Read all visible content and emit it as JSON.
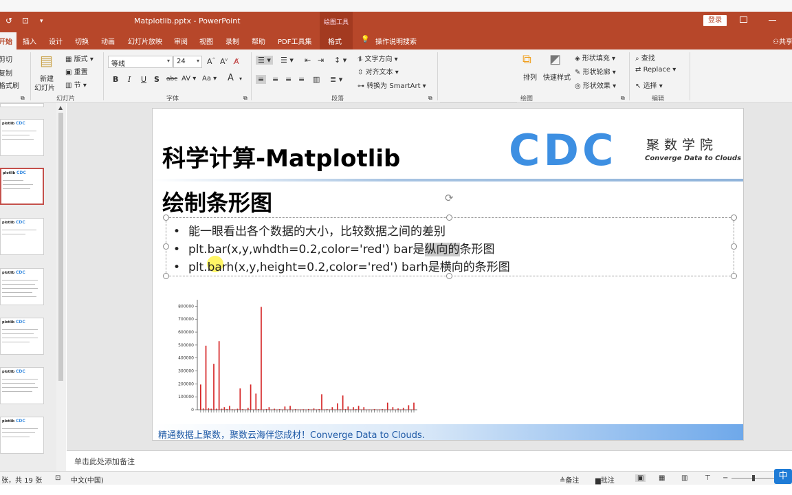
{
  "window": {
    "doc_title": "Matplotlib.pptx - PowerPoint",
    "context_tab_group": "绘图工具",
    "login_label": "登录"
  },
  "tabs": [
    {
      "label": "开始"
    },
    {
      "label": "插入"
    },
    {
      "label": "设计"
    },
    {
      "label": "切换"
    },
    {
      "label": "动画"
    },
    {
      "label": "幻灯片放映"
    },
    {
      "label": "审阅"
    },
    {
      "label": "视图"
    },
    {
      "label": "录制"
    },
    {
      "label": "帮助"
    },
    {
      "label": "PDF工具集"
    },
    {
      "label": "格式"
    },
    {
      "label": "操作说明搜索"
    },
    {
      "label": "共享"
    }
  ],
  "ribbon": {
    "clipboard": {
      "cut": "剪切",
      "copy": "复制",
      "format_painter": "格式刷"
    },
    "slides": {
      "new_slide_line1": "新建",
      "new_slide_line2": "幻灯片",
      "layout": "版式",
      "reset": "重置",
      "section": "节",
      "group": "幻灯片"
    },
    "font": {
      "family": "等线",
      "size": "24",
      "group": "字体",
      "spacing": "AV",
      "case": "Aa"
    },
    "paragraph": {
      "text_direction": "文字方向",
      "align_text": "对齐文本",
      "smartart": "转换为 SmartArt",
      "group": "段落"
    },
    "drawing": {
      "arrange": "排列",
      "quick_styles": "快速样式",
      "shape_fill": "形状填充",
      "shape_outline": "形状轮廓",
      "shape_effects": "形状效果",
      "group": "绘图"
    },
    "editing": {
      "find": "查找",
      "replace": "Replace",
      "select": "选择",
      "group": "编辑"
    }
  },
  "slide": {
    "title": "科学计算-Matplotlib",
    "logo_text": "CDC",
    "logo_cn": "聚数学院",
    "logo_en": "Converge Data to Clouds",
    "subtitle": "绘制条形图",
    "bullets": [
      {
        "text": "能一眼看出各个数据的大小，比较数据之间的差别"
      },
      {
        "pre": "plt.bar(x,y,whdth=0.2,color='red') bar是",
        "hl": "纵向的",
        "post": "条形图"
      },
      {
        "text": "plt.barh(x,y,height=0.2,color='red') barh是横向的条形图"
      }
    ],
    "footer": "精通数据上聚数，聚数云海伴您成材！Converge Data to Clouds."
  },
  "chart_data": {
    "type": "bar",
    "color": "#d62728",
    "ylim": [
      0,
      850000
    ],
    "yticks": [
      "0",
      "100000",
      "200000",
      "300000",
      "400000",
      "500000",
      "600000",
      "700000",
      "800000"
    ],
    "values": [
      195000,
      10000,
      495000,
      12000,
      8000,
      355000,
      8000,
      530000,
      8000,
      20000,
      6000,
      30000,
      4000,
      3000,
      8000,
      165000,
      5000,
      2000,
      15000,
      195000,
      3000,
      125000,
      5000,
      795000,
      3000,
      6000,
      20000,
      3000,
      8000,
      2000,
      5000,
      3000,
      25000,
      2000,
      30000,
      2000,
      5000,
      3000,
      3000,
      4000,
      2000,
      6000,
      3000,
      10000,
      3000,
      5000,
      120000,
      3000,
      5000,
      3000,
      20000,
      3000,
      50000,
      4000,
      110000,
      5000,
      25000,
      3000,
      20000,
      5000,
      30000,
      3000,
      20000,
      2000,
      3000,
      2000,
      5000,
      2000,
      3000,
      5000,
      3000,
      55000,
      3000,
      20000,
      2000,
      10000,
      3000,
      15000,
      2000,
      35000,
      3000,
      55000
    ]
  },
  "notes": {
    "placeholder": "单击此处添加备注"
  },
  "status": {
    "slide_pos": "张，共 19 张",
    "language": "中文(中国)",
    "notes_btn": "备注",
    "comments_btn": "批注",
    "ime": "中"
  },
  "thumbnails": [
    {
      "title": "plotlib",
      "logo": "CDC"
    },
    {
      "title": "plotlib",
      "logo": "CDC"
    },
    {
      "title": "plotlib",
      "logo": "CDC"
    },
    {
      "title": "plotlib",
      "logo": "CDC"
    },
    {
      "title": "plotlib",
      "logo": "CDC"
    },
    {
      "title": "plotlib",
      "logo": "CDC"
    },
    {
      "title": "plotlib",
      "logo": "CDC"
    }
  ]
}
